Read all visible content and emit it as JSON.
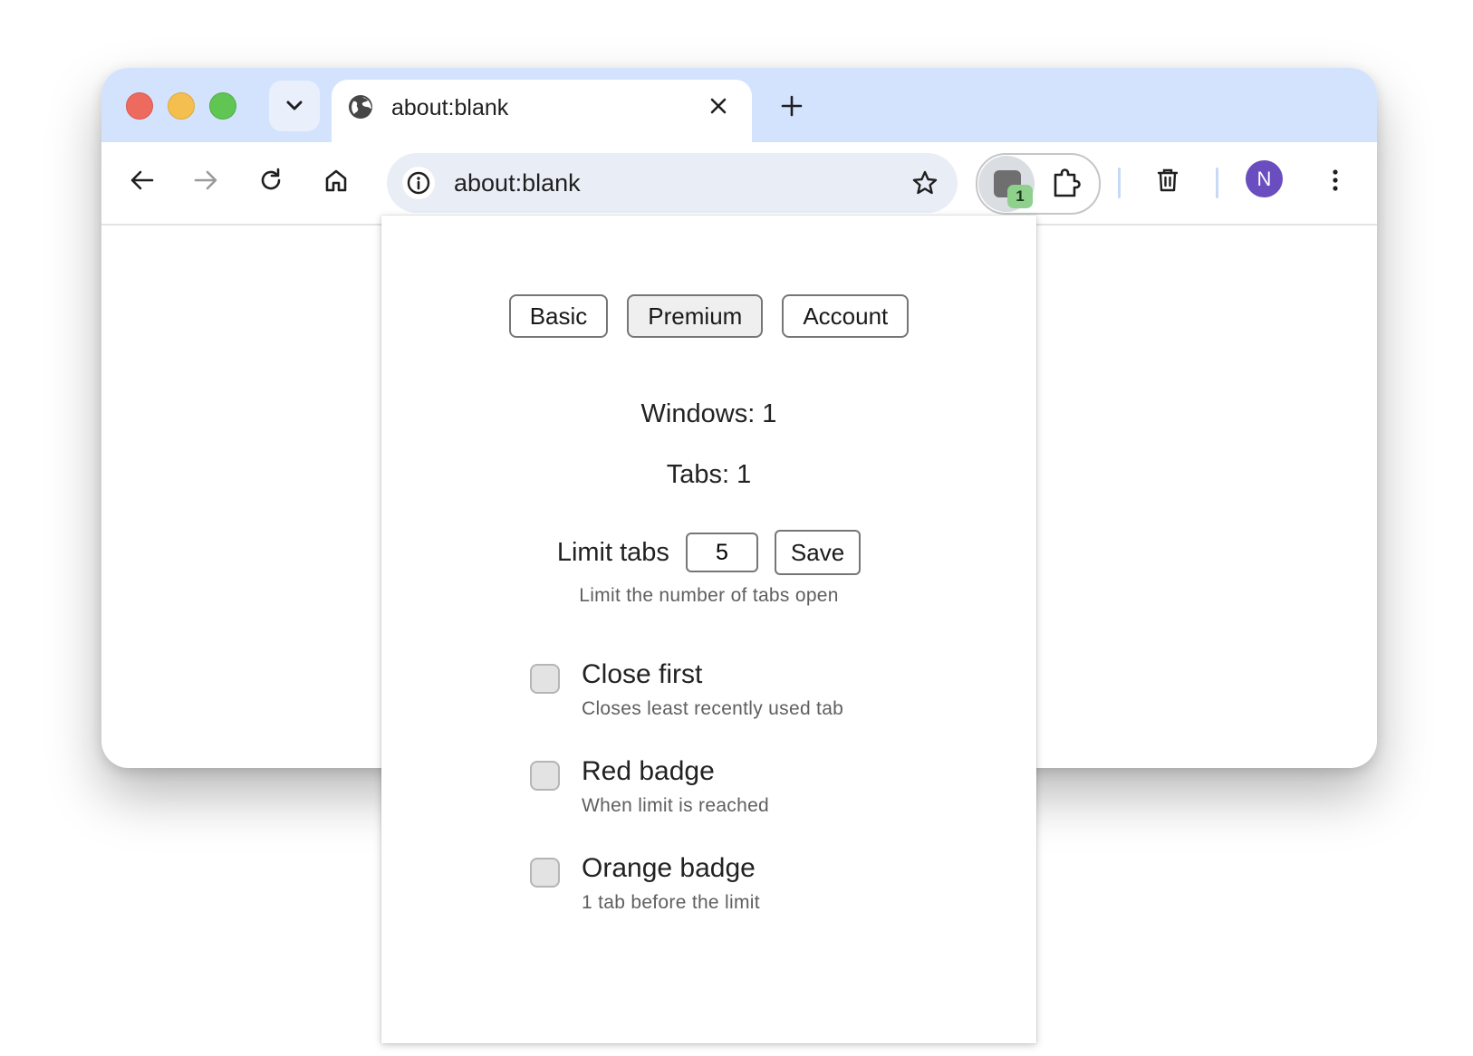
{
  "browser": {
    "tab": {
      "title": "about:blank"
    },
    "omnibox": {
      "url": "about:blank"
    },
    "extension": {
      "badge": "1"
    },
    "profile": {
      "initial": "N"
    }
  },
  "popup": {
    "tabs": [
      {
        "label": "Basic",
        "active": false
      },
      {
        "label": "Premium",
        "active": true
      },
      {
        "label": "Account",
        "active": false
      }
    ],
    "windows_text": "Windows: 1",
    "tabs_text": "Tabs: 1",
    "limit": {
      "label": "Limit tabs",
      "value": "5",
      "save_label": "Save",
      "hint": "Limit the number of tabs open"
    },
    "options": [
      {
        "title": "Close first",
        "description": "Closes least recently used tab",
        "checked": false
      },
      {
        "title": "Red badge",
        "description": "When limit is reached",
        "checked": false
      },
      {
        "title": "Orange badge",
        "description": "1 tab before the limit",
        "checked": false
      }
    ]
  },
  "colors": {
    "tabstrip": "#d3e3fd",
    "avatar": "#6a4dbf",
    "badge": "#8ed08c"
  }
}
